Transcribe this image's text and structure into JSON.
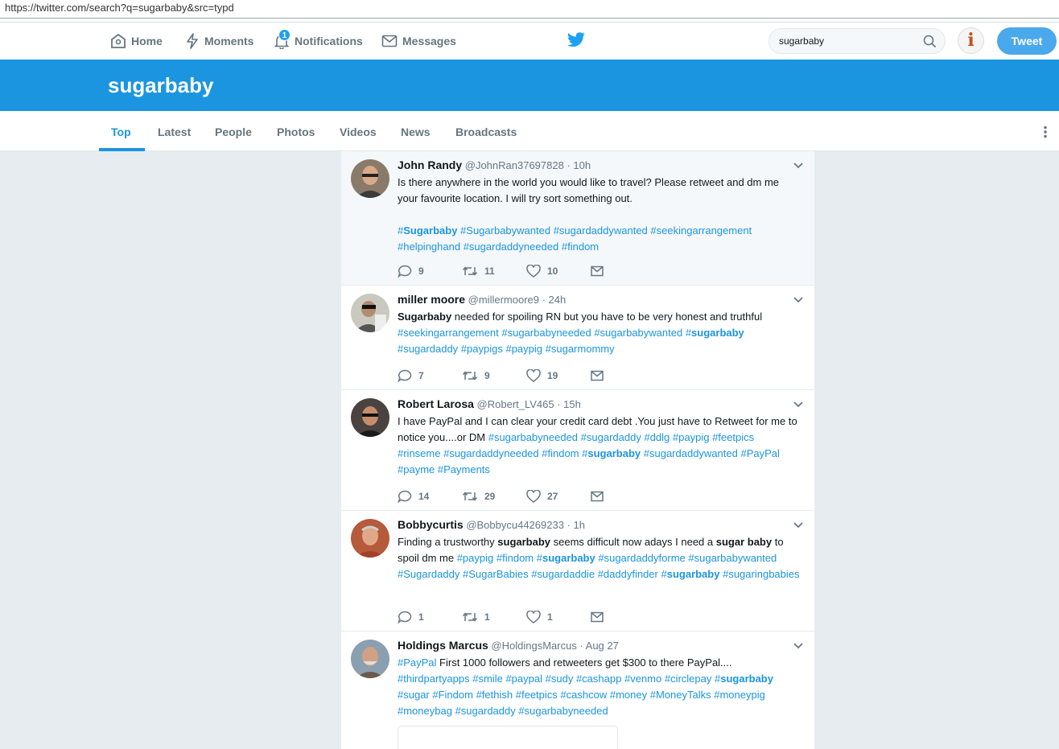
{
  "browser": {
    "url": "https://twitter.com/search?q=sugarbaby&src=typd"
  },
  "nav": {
    "home": "Home",
    "moments": "Moments",
    "notifications": "Notifications",
    "notifications_count": "1",
    "messages": "Messages",
    "search_value": "sugarbaby",
    "info": "i",
    "tweet_button": "Tweet"
  },
  "banner": {
    "title": "sugarbaby"
  },
  "tabs": [
    "Top",
    "Latest",
    "People",
    "Photos",
    "Videos",
    "News",
    "Broadcasts"
  ],
  "tweets": [
    {
      "name": "John Randy",
      "meta": "@JohnRan37697828 · 10h",
      "replies": "9",
      "retweets": "11",
      "likes": "10"
    },
    {
      "name": "miller moore",
      "meta": "@millermoore9 · 24h",
      "replies": "7",
      "retweets": "9",
      "likes": "19"
    },
    {
      "name": "Robert Larosa",
      "meta": "@Robert_LV465 · 15h",
      "replies": "14",
      "retweets": "29",
      "likes": "27"
    },
    {
      "name": "Bobbycurtis",
      "meta": "@Bobbycu44269233 · 1h",
      "replies": "1",
      "retweets": "1",
      "likes": "1"
    },
    {
      "name": "Holdings Marcus",
      "meta": "@HoldingsMarcus · Aug 27"
    }
  ],
  "colors": {
    "brand": "#1b95e0",
    "timeline_bg": "#e6ecf0"
  },
  "icons": [
    "home-icon",
    "lightning-icon",
    "bell-icon",
    "envelope-icon",
    "twitter-bird-icon",
    "search-icon",
    "info-icon",
    "reply-icon",
    "retweet-icon",
    "heart-icon",
    "mail-icon",
    "chevron-down-icon",
    "more-dots-icon"
  ]
}
